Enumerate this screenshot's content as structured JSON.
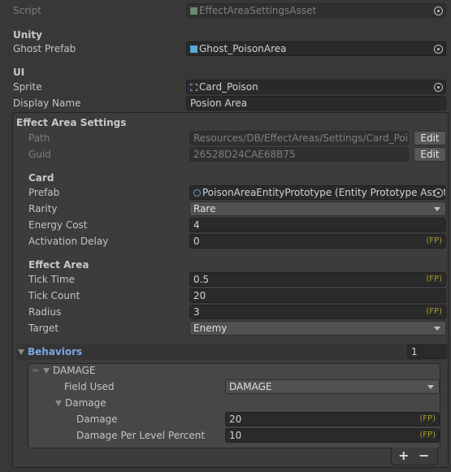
{
  "script": {
    "label": "Script",
    "value": "EffectAreaSettingsAsset",
    "icon": "script-icon"
  },
  "unity": {
    "header": "Unity",
    "ghost_prefab": {
      "label": "Ghost Prefab",
      "value": "Ghost_PoisonArea",
      "icon": "prefab-cube-icon"
    }
  },
  "ui": {
    "header": "UI",
    "sprite": {
      "label": "Sprite",
      "value": "Card_Poison",
      "icon": "sprite-icon"
    },
    "display_name": {
      "label": "Display Name",
      "value": "Posion Area"
    }
  },
  "settings": {
    "header": "Effect Area Settings",
    "path": {
      "label": "Path",
      "value": "Resources/DB/EffectAreas/Settings/Card_Poison",
      "edit": "Edit"
    },
    "guid": {
      "label": "Guid",
      "value": "26528D24CAE68B75",
      "edit": "Edit"
    },
    "card": {
      "header": "Card",
      "prefab": {
        "label": "Prefab",
        "value": "PoisonAreaEntityPrototype (Entity Prototype Asset)",
        "icon": "entity-prototype-icon"
      },
      "rarity": {
        "label": "Rarity",
        "value": "Rare"
      },
      "energy_cost": {
        "label": "Energy Cost",
        "value": "4"
      },
      "activation_delay": {
        "label": "Activation Delay",
        "value": "0",
        "suffix": "(FP)"
      }
    },
    "effect_area": {
      "header": "Effect Area",
      "tick_time": {
        "label": "Tick Time",
        "value": "0.5",
        "suffix": "(FP)"
      },
      "tick_count": {
        "label": "Tick Count",
        "value": "20"
      },
      "radius": {
        "label": "Radius",
        "value": "3",
        "suffix": "(FP)"
      },
      "target": {
        "label": "Target",
        "value": "Enemy"
      }
    },
    "behaviors": {
      "label": "Behaviors",
      "count": "1",
      "item": {
        "title": "DAMAGE",
        "field_used": {
          "label": "Field Used",
          "value": "DAMAGE"
        },
        "damage_group": "Damage",
        "damage": {
          "label": "Damage",
          "value": "20",
          "suffix": "(FP)"
        },
        "per_level": {
          "label": "Damage Per Level Percent",
          "value": "10",
          "suffix": "(FP)"
        }
      },
      "add": "+",
      "remove": "−"
    }
  },
  "colors": {
    "background": "#383838",
    "accent_label": "#7ba7e6",
    "fp_suffix": "#a89a2a"
  }
}
